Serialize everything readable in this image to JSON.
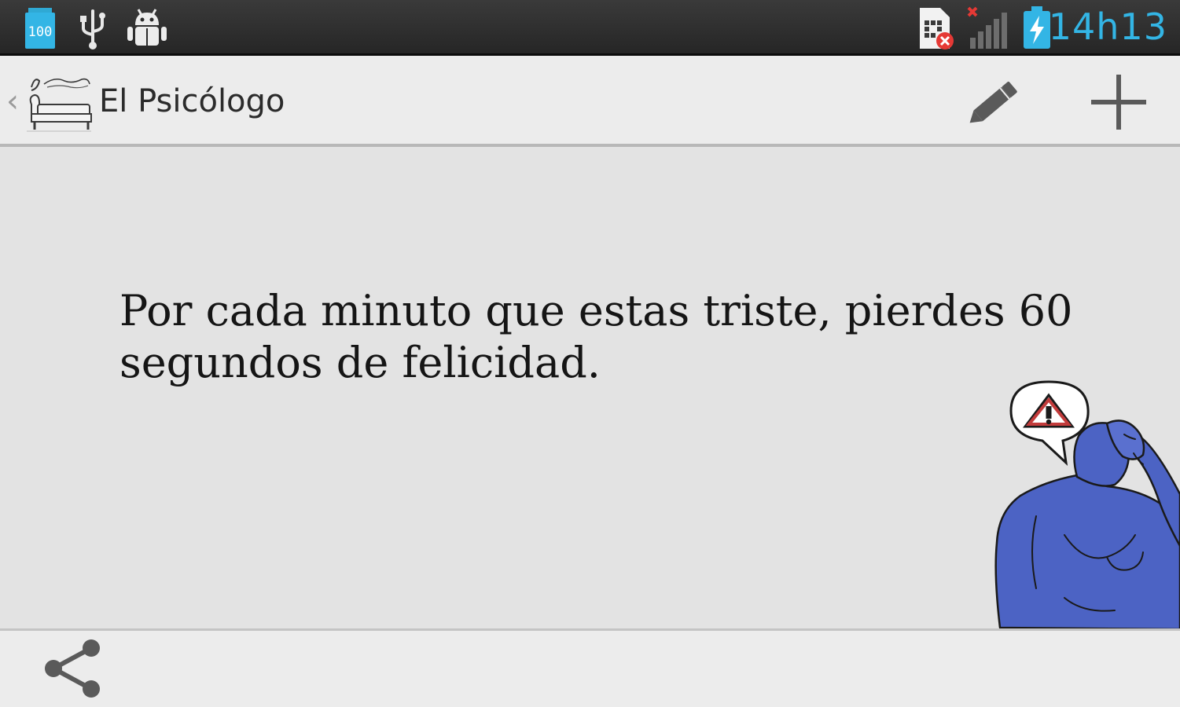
{
  "status_bar": {
    "time": "14h13",
    "battery_saver_label": "100",
    "icons": [
      "battery-saver-icon",
      "usb-icon",
      "android-debug-icon",
      "sim-error-icon",
      "signal-icon",
      "battery-charging-icon"
    ],
    "accent_color": "#33b5e5"
  },
  "action_bar": {
    "title": "El Psicólogo",
    "logo_icon": "app-logo-couch-icon",
    "edit_icon": "pencil-icon",
    "add_icon": "plus-icon"
  },
  "content": {
    "quote": "Por cada minuto que estas triste, pierdes 60 segundos de felicidad.",
    "illustration": "sad-blue-man-with-warning-bubble",
    "figure_color": "#4c63c4"
  },
  "bottom_bar": {
    "share_icon": "share-icon"
  }
}
